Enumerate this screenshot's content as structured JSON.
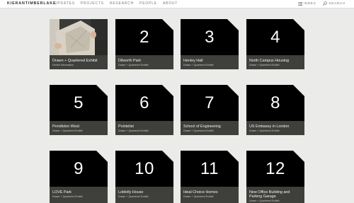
{
  "header": {
    "brand": "KIERANTIMBERLAKE",
    "nav": [
      "UPDATES",
      "PROJECTS",
      "RESEARCH",
      "PEOPLE",
      "ABOUT"
    ],
    "index_label": "INDEX",
    "search_label": "SEARCH"
  },
  "tiles": [
    {
      "number": "",
      "title": "Drawn + Quartered Exhibit",
      "subtitle": "Exhibit Information",
      "photo": true
    },
    {
      "number": "2",
      "title": "Dilworth Park",
      "subtitle": "Drawn + Quartered Exhibit"
    },
    {
      "number": "3",
      "title": "Henley Hall",
      "subtitle": "Drawn + Quartered Exhibit"
    },
    {
      "number": "4",
      "title": "North Campus Housing",
      "subtitle": "Drawn + Quartered Exhibit"
    },
    {
      "number": "5",
      "title": "Pendleton West",
      "subtitle": "Drawn + Quartered Exhibit"
    },
    {
      "number": "6",
      "title": "Pointelist",
      "subtitle": "Drawn + Quartered Exhibit"
    },
    {
      "number": "7",
      "title": "School of Engineering",
      "subtitle": "Drawn + Quartered Exhibit"
    },
    {
      "number": "8",
      "title": "US Embassy in London",
      "subtitle": "Drawn + Quartered Exhibit"
    },
    {
      "number": "9",
      "title": "LOVE Park",
      "subtitle": "Drawn + Quartered Exhibit"
    },
    {
      "number": "10",
      "title": "Loblolly House",
      "subtitle": "Drawn + Quartered Exhibit"
    },
    {
      "number": "11",
      "title": "Ideal Choice Homes",
      "subtitle": "Drawn + Quartered Exhibit"
    },
    {
      "number": "12",
      "title": "New Office Building and Parking Garage",
      "subtitle": "Drawn + Quartered Exhibit"
    }
  ]
}
